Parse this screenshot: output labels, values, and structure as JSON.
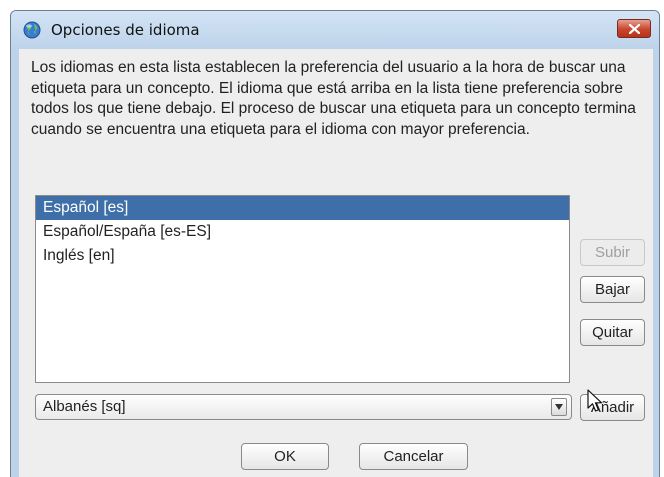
{
  "window": {
    "title": "Opciones de idioma",
    "description": "Los idiomas en esta lista establecen la preferencia del usuario a la hora de buscar una etiqueta para un concepto. El idioma que está arriba en la lista tiene preferencia sobre todos los que tiene debajo. El proceso de buscar una etiqueta para un concepto termina cuando se encuentra una etiqueta para el idioma con mayor preferencia."
  },
  "languages": [
    {
      "label": "Español [es]",
      "selected": true
    },
    {
      "label": "Español/España [es-ES]",
      "selected": false
    },
    {
      "label": "Inglés [en]",
      "selected": false
    }
  ],
  "side_buttons": {
    "up": "Subir",
    "down": "Bajar",
    "remove": "Quitar",
    "add": "Añadir"
  },
  "combo": {
    "value": "Albanés [sq]"
  },
  "footer": {
    "ok": "OK",
    "cancel": "Cancelar"
  },
  "colors": {
    "selection": "#3e6fa8",
    "titlebar": "#bdd3ea",
    "close_button": "#c8452e"
  },
  "icons": {
    "app": "globe-icon",
    "close": "close-icon",
    "dropdown": "chevron-down-icon",
    "pointer": "mouse-cursor-icon"
  }
}
